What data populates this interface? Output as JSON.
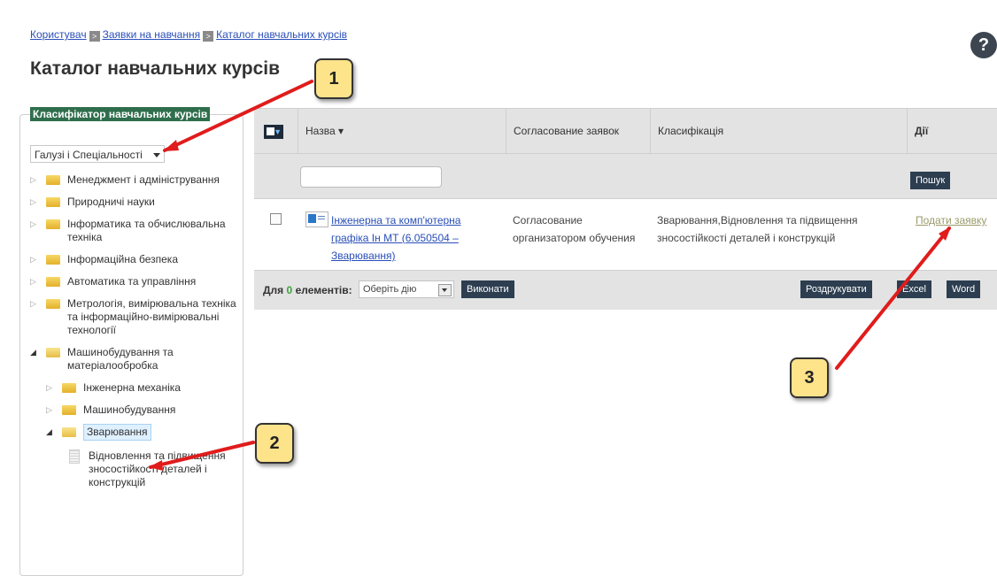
{
  "breadcrumb": {
    "items": [
      "Користувач",
      "Заявки на навчання",
      "Каталог навчальних курсів"
    ],
    "separator": ">"
  },
  "help_glyph": "?",
  "page_title": "Каталог навчальних курсів",
  "left_panel": {
    "legend": "Класифікатор навчальних курсів",
    "select_value": "Галузі і Спеціальності",
    "tree": [
      {
        "label": "Менеджмент і адміністрування",
        "level": 0,
        "expanded": false,
        "icon": "folder-icon"
      },
      {
        "label": "Природничі науки",
        "level": 0,
        "expanded": false,
        "icon": "folder-icon"
      },
      {
        "label": "Інформатика та обчислювальна техніка",
        "level": 0,
        "expanded": false,
        "icon": "folder-icon"
      },
      {
        "label": "Інформаційна безпека",
        "level": 0,
        "expanded": false,
        "icon": "folder-icon"
      },
      {
        "label": "Автоматика та управління",
        "level": 0,
        "expanded": false,
        "icon": "folder-icon"
      },
      {
        "label": "Метрологія, вимірювальна техніка та інформаційно-вимірювальні технології",
        "level": 0,
        "expanded": false,
        "icon": "folder-icon"
      },
      {
        "label": "Машинобудування та матеріалообробка",
        "level": 0,
        "expanded": true,
        "icon": "folder-open-icon"
      },
      {
        "label": "Інженерна механіка",
        "level": 1,
        "expanded": false,
        "icon": "folder-icon"
      },
      {
        "label": "Машинобудування",
        "level": 1,
        "expanded": false,
        "icon": "folder-icon"
      },
      {
        "label": "Зварювання",
        "level": 1,
        "expanded": true,
        "icon": "folder-open-icon",
        "selected": true
      },
      {
        "label": "Відновлення та підвищення зносостійкості деталей і конструкцій",
        "level": 2,
        "icon": "document-icon"
      }
    ]
  },
  "grid": {
    "headers": {
      "name": "Назва",
      "approval": "Согласование заявок",
      "classification": "Класифікація",
      "actions": "Дії"
    },
    "search_button": "Пошук",
    "rows": [
      {
        "name": "Інженерна та комп'ютерна графіка Ін МТ (6.050504 – Зварювання)",
        "approval": "Согласование организатором обучения",
        "classification": "Зварювання,Відновлення та підвищення зносостійкості деталей і конструкцій",
        "action": "Подати заявку"
      }
    ],
    "footer": {
      "label_prefix": "Для",
      "count": "0",
      "label_suffix": "елементів:",
      "action_select": "Оберіть дію",
      "execute": "Виконати",
      "print": "Роздрукувати",
      "excel": "Excel",
      "word": "Word"
    }
  },
  "callouts": [
    "1",
    "2",
    "3"
  ],
  "colors": {
    "link": "#2a4fb8",
    "legend_bg": "#2f6e4c",
    "button_dark": "#2c3e50",
    "grid_header": "#e3e3e3",
    "arrow": "#e01c1c",
    "callout_bg": "#fde38a"
  }
}
